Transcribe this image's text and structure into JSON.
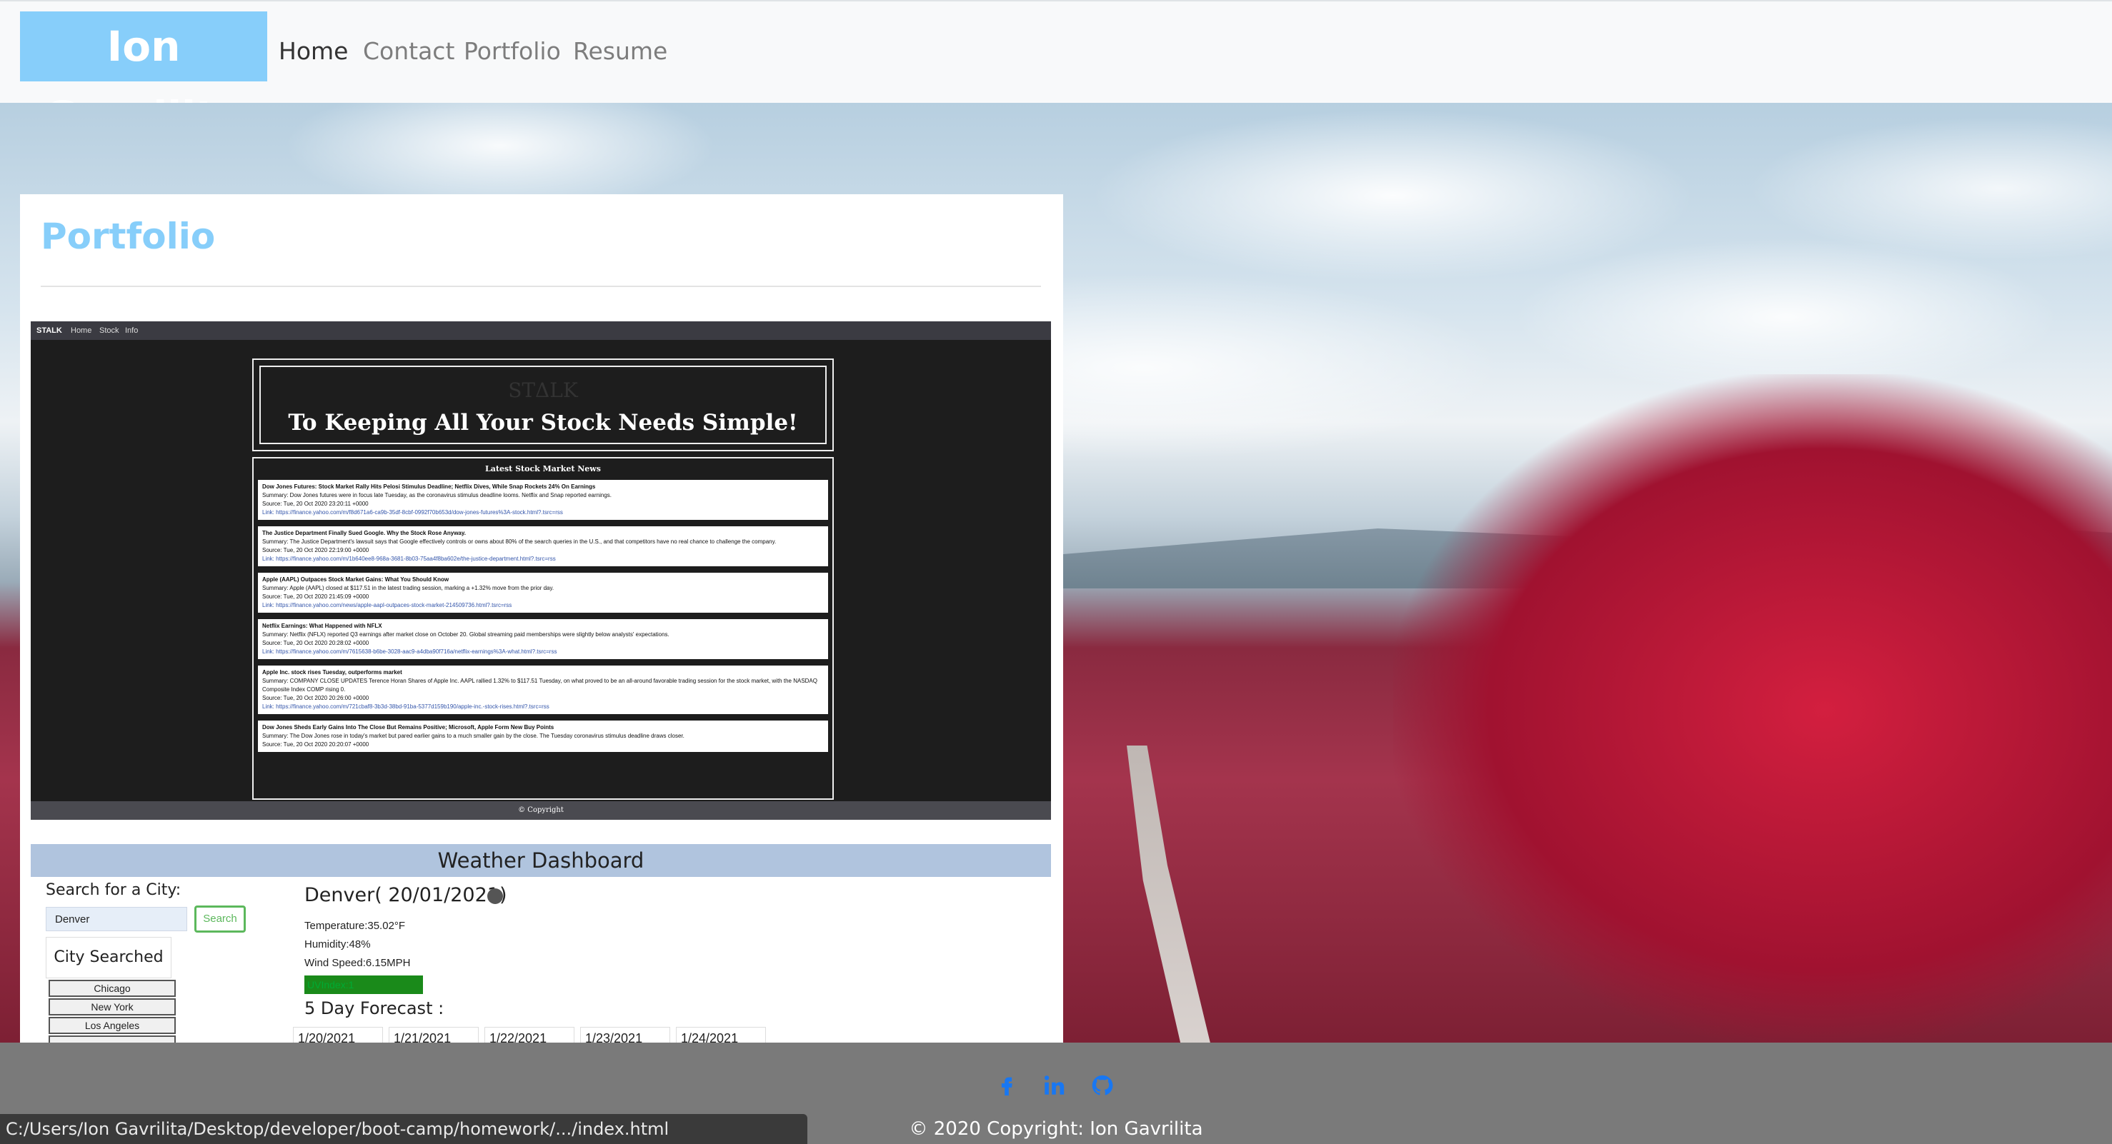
{
  "nav": {
    "brand": "Ion Gavrilita",
    "links": [
      "Home",
      "Contact",
      "Portfolio",
      "Resume"
    ]
  },
  "portfolio": {
    "title": "Portfolio",
    "stalk": {
      "nav": [
        "STALK",
        "Home",
        "Stock",
        "Info"
      ],
      "logo": "STΔLK",
      "tagline": "To Keeping All Your Stock Needs Simple!",
      "news_heading": "Latest Stock Market News",
      "news": [
        {
          "title": "Dow Jones Futures: Stock Market Rally Hits Pelosi Stimulus Deadline; Netflix Dives, While Snap Rockets 24% On Earnings",
          "summary": "Summary: Dow Jones futures were in focus late Tuesday, as the coronavirus stimulus deadline looms. Netflix and Snap reported earnings.",
          "source": "Source: Tue, 20 Oct 2020 23:20:11 +0000",
          "link": "Link: https://finance.yahoo.com/m/f8d671a6-ca9b-35df-8cbf-0992f70b653d/dow-jones-futures%3A-stock.html?.tsrc=rss"
        },
        {
          "title": "The Justice Department Finally Sued Google. Why the Stock Rose Anyway.",
          "summary": "Summary: The Justice Department's lawsuit says that Google effectively controls or owns about 80% of the search queries in the U.S., and that competitors have no real chance to challenge the company.",
          "source": "Source: Tue, 20 Oct 2020 22:19:00 +0000",
          "link": "Link: https://finance.yahoo.com/m/1b640ee8-968a-3681-8b03-75aa4f8ba602e/the-justice-department.html?.tsrc=rss"
        },
        {
          "title": "Apple (AAPL) Outpaces Stock Market Gains: What You Should Know",
          "summary": "Summary: Apple (AAPL) closed at $117.51 in the latest trading session, marking a +1.32% move from the prior day.",
          "source": "Source: Tue, 20 Oct 2020 21:45:09 +0000",
          "link": "Link: https://finance.yahoo.com/news/apple-aapl-outpaces-stock-market-214509736.html?.tsrc=rss"
        },
        {
          "title": "Netflix Earnings: What Happened with NFLX",
          "summary": "Summary: Netflix (NFLX) reported Q3 earnings after market close on October 20. Global streaming paid memberships were slightly below analysts' expectations.",
          "source": "Source: Tue, 20 Oct 2020 20:28:02 +0000",
          "link": "Link: https://finance.yahoo.com/m/7615638-b6be-3028-aac9-a4dba90f716a/netflix-earnings%3A-what.html?.tsrc=rss"
        },
        {
          "title": "Apple Inc. stock rises Tuesday, outperforms market",
          "summary": "Summary: COMPANY CLOSE UPDATES Terence Horan Shares of Apple Inc. AAPL rallied 1.32% to $117.51 Tuesday, on what proved to be an all-around favorable trading session for the stock market, with the NASDAQ Composite Index COMP rising 0.",
          "source": "Source: Tue, 20 Oct 2020 20:26:00 +0000",
          "link": "Link: https://finance.yahoo.com/m/721cbaf8-3b3d-38bd-91ba-5377d159b190/apple-inc.-stock-rises.html?.tsrc=rss"
        },
        {
          "title": "Dow Jones Sheds Early Gains Into The Close But Remains Positive; Microsoft, Apple Form New Buy Points",
          "summary": "Summary: The Dow Jones rose in today's market but pared earlier gains to a much smaller gain by the close. The Tuesday coronavirus stimulus deadline draws closer.",
          "source": "Source: Tue, 20 Oct 2020 20:20:07 +0000",
          "link": ""
        }
      ],
      "footer": "© Copyright"
    },
    "weather": {
      "title": "Weather Dashboard",
      "search_label": "Search for a City:",
      "search_value": "Denver",
      "search_button": "Search",
      "city_searched_title": "City Searched",
      "cities": [
        "Chicago",
        "New York",
        "Los Angeles"
      ],
      "current_city": "Denver( 20/01/2021)",
      "temperature": "Temperature:35.02°F",
      "humidity": "Humidity:48%",
      "wind": "Wind Speed:6.15MPH",
      "uv": "UVIndex:1",
      "forecast_title": "5 Day Forecast :",
      "forecast_days": [
        "1/20/2021",
        "1/21/2021",
        "1/22/2021",
        "1/23/2021",
        "1/24/2021"
      ]
    }
  },
  "footer": {
    "social": [
      "facebook-icon",
      "linkedin-icon",
      "github-icon"
    ],
    "copyright": "© 2020 Copyright: Ion Gavrilita"
  },
  "statusbar": {
    "url": "C:/Users/Ion Gavrilita/Desktop/developer/boot-camp/homework/.../index.html"
  },
  "colors": {
    "brand_bg": "#87cefa",
    "portfolio_title": "#87cefa",
    "weather_bar": "#b0c4de",
    "social_icon": "#1877f2"
  }
}
